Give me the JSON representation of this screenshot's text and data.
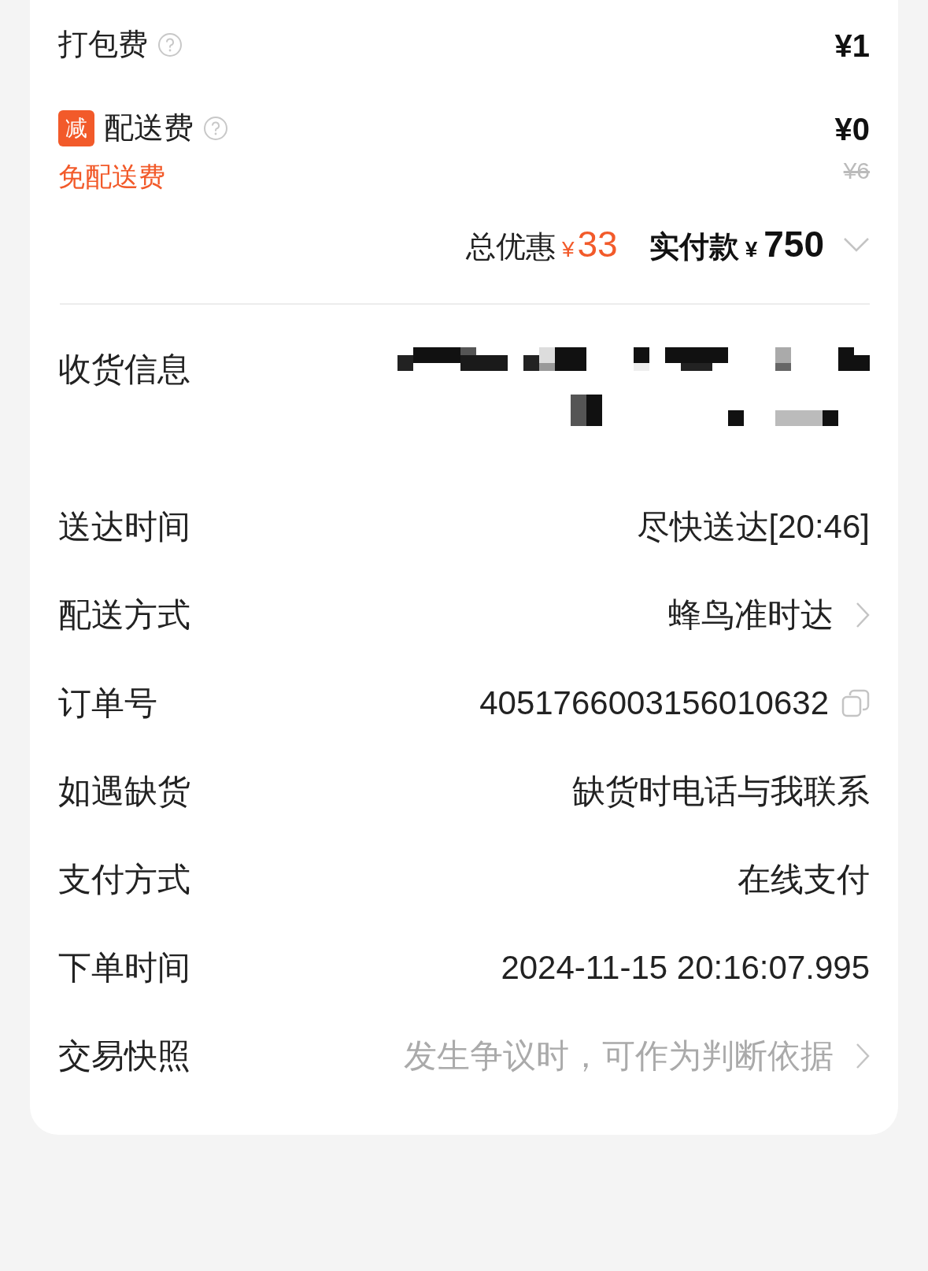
{
  "fees": [
    {
      "label": "打包费",
      "price": "¥1"
    },
    {
      "label": "配送费",
      "badge": "减",
      "price": "¥0",
      "sub": "免配送费",
      "original": "¥6"
    }
  ],
  "summary": {
    "discount_label": "总优惠",
    "discount_currency": "¥",
    "discount": "33",
    "paid_label": "实付款",
    "paid_currency": "¥",
    "paid": "750",
    "expanded": false
  },
  "info": [
    {
      "label": "收货信息",
      "kind": "redacted"
    },
    {
      "label": "送达时间",
      "kind": "text",
      "value": "尽快送达[20:46]"
    },
    {
      "label": "配送方式",
      "kind": "link",
      "value": "蜂鸟准时达"
    },
    {
      "label": "订单号",
      "kind": "copy",
      "value": "4051766003156010632"
    },
    {
      "label": "如遇缺货",
      "kind": "text",
      "value": "缺货时电话与我联系"
    },
    {
      "label": "支付方式",
      "kind": "text",
      "value": "在线支付"
    },
    {
      "label": "下单时间",
      "kind": "text",
      "value": "2024-11-15 20:16:07.995"
    },
    {
      "label": "交易快照",
      "kind": "hint",
      "value": "发生争议时，可作为判断依据"
    }
  ]
}
